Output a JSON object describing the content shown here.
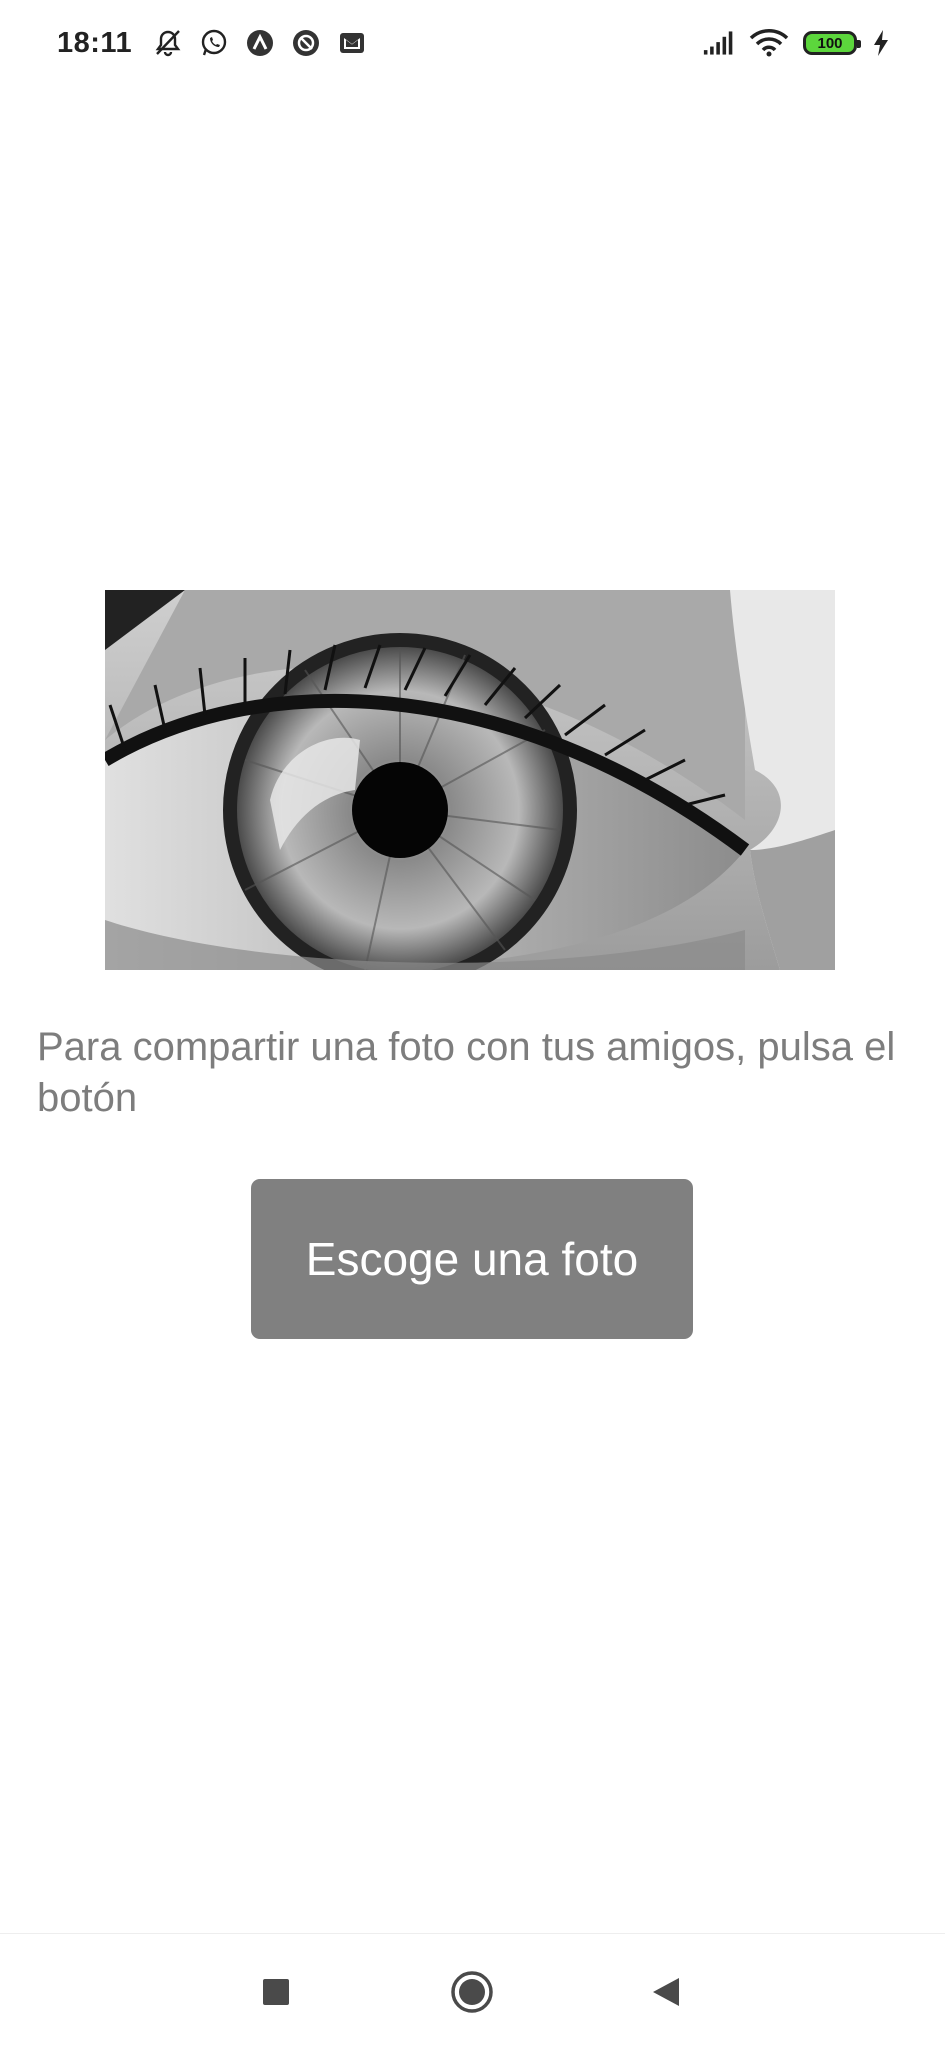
{
  "status_bar": {
    "time": "18:11",
    "notification_icons": [
      "muted-bell-icon",
      "whatsapp-icon",
      "app-a-icon",
      "blocked-icon",
      "gmail-icon"
    ],
    "signal_icon": "signal-icon",
    "wifi_icon": "wifi-icon",
    "battery_level": "100",
    "charging_icon": "charging-bolt-icon"
  },
  "main": {
    "image_alt": "eye photo",
    "description": "Para compartir una foto con tus amigos, pulsa el botón",
    "button_label": "Escoge una foto"
  },
  "nav_bar": {
    "recents_icon": "square-icon",
    "home_icon": "circle-icon",
    "back_icon": "triangle-back-icon"
  },
  "colors": {
    "button_bg": "#808080",
    "description_text": "#7d7d7d",
    "battery_fill": "#5cd63c"
  }
}
